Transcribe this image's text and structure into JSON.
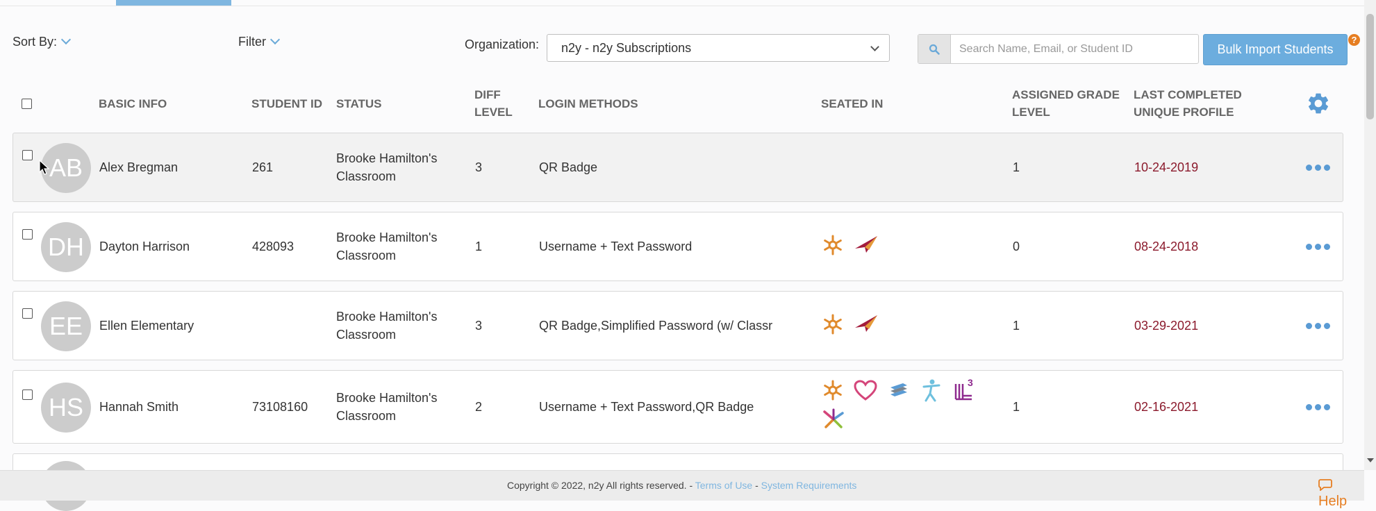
{
  "toolbar": {
    "sort_label": "Sort By:",
    "filter_label": "Filter",
    "org_label": "Organization:",
    "org_value": "n2y - n2y Subscriptions",
    "search_placeholder": "Search Name, Email, or Student ID",
    "bulk_import_label": "Bulk Import Students",
    "help_q": "?"
  },
  "columns": {
    "basic_info": "BASIC INFO",
    "student_id": "STUDENT ID",
    "status": "STATUS",
    "diff_level_1": "DIFF",
    "diff_level_2": "LEVEL",
    "login_methods": "LOGIN METHODS",
    "seated_in": "SEATED IN",
    "grade_1": "ASSIGNED GRADE",
    "grade_2": "LEVEL",
    "last_1": "LAST COMPLETED",
    "last_2": "UNIQUE PROFILE"
  },
  "students": [
    {
      "initials": "AB",
      "name": "Alex Bregman",
      "id": "261",
      "status_1": "Brooke Hamilton's",
      "status_2": "Classroom",
      "diff": "3",
      "login": "QR Badge",
      "grade": "1",
      "last": "10-24-2019"
    },
    {
      "initials": "DH",
      "name": "Dayton Harrison",
      "id": "428093",
      "status_1": "Brooke Hamilton's",
      "status_2": "Classroom",
      "diff": "1",
      "login": "Username + Text Password",
      "grade": "0",
      "last": "08-24-2018"
    },
    {
      "initials": "EE",
      "name": "Ellen Elementary",
      "id": "",
      "status_1": "Brooke Hamilton's",
      "status_2": "Classroom",
      "diff": "3",
      "login": "QR Badge,Simplified Password (w/ Classr",
      "grade": "1",
      "last": "03-29-2021"
    },
    {
      "initials": "HS",
      "name": "Hannah Smith",
      "id": "73108160",
      "status_1": "Brooke Hamilton's",
      "status_2": "Classroom",
      "diff": "2",
      "login": "Username + Text Password,QR Badge",
      "grade": "1",
      "last": "02-16-2021"
    }
  ],
  "footer": {
    "copyright": "Copyright © 2022, n2y All rights reserved. - ",
    "terms": "Terms of Use",
    "sep": " - ",
    "sysreq": "System Requirements",
    "help": "Help"
  },
  "colors": {
    "accent": "#6cadde",
    "date": "#8b1a2c",
    "help": "#e67e22"
  }
}
